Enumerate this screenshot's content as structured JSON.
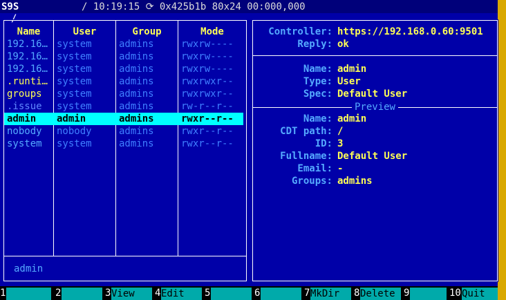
{
  "titlebar": {
    "app": "S9S",
    "status": "/ 10:19:15 ⟳ 0x425b1b 80x24 00:000,000"
  },
  "left_pane": {
    "path": "/",
    "headers": [
      "Name",
      "User",
      "Group",
      "Mode"
    ],
    "rows": [
      {
        "name": "192.16…",
        "user": "system",
        "group": "admins",
        "mode": "rwxrw----",
        "color": "#55aaff"
      },
      {
        "name": "192.16…",
        "user": "system",
        "group": "admins",
        "mode": "rwxrw----",
        "color": "#55aaff"
      },
      {
        "name": "192.16…",
        "user": "system",
        "group": "admins",
        "mode": "rwxrw----",
        "color": "#55aaff"
      },
      {
        "name": ".runti…",
        "user": "system",
        "group": "admins",
        "mode": "rwxrwxr--",
        "color": "#ffff55"
      },
      {
        "name": "groups",
        "user": "system",
        "group": "admins",
        "mode": "rwxrwxr--",
        "color": "#ffff55"
      },
      {
        "name": ".issue",
        "user": "system",
        "group": "admins",
        "mode": "rw-r--r--",
        "color": "#5f87ff"
      },
      {
        "name": "admin",
        "user": "admin",
        "group": "admins",
        "mode": "rwxr--r--",
        "color": "#000000",
        "selected": true
      },
      {
        "name": "nobody",
        "user": "nobody",
        "group": "admins",
        "mode": "rwxr--r--",
        "color": "#55aaff"
      },
      {
        "name": "system",
        "user": "system",
        "group": "admins",
        "mode": "rwxr--r--",
        "color": "#55aaff"
      }
    ],
    "current": "admin"
  },
  "right_pane": {
    "info": [
      {
        "key": "Controller:",
        "value": "https://192.168.0.60:9501"
      },
      {
        "key": "Reply:",
        "value": "ok"
      }
    ],
    "details": [
      {
        "key": "Name:",
        "value": "admin"
      },
      {
        "key": "Type:",
        "value": "User"
      },
      {
        "key": "Spec:",
        "value": "Default User"
      }
    ],
    "preview_title": "Preview",
    "preview": [
      {
        "key": "Name:",
        "value": "admin"
      },
      {
        "key": "CDT path:",
        "value": "/"
      },
      {
        "key": "ID:",
        "value": "3"
      },
      {
        "key": "Fullname:",
        "value": "Default User"
      },
      {
        "key": "Email:",
        "value": "-"
      },
      {
        "key": "Groups:",
        "value": "admins"
      }
    ]
  },
  "function_keys": [
    {
      "num": "1",
      "label": ""
    },
    {
      "num": "2",
      "label": ""
    },
    {
      "num": "3",
      "label": "View"
    },
    {
      "num": "4",
      "label": "Edit"
    },
    {
      "num": "5",
      "label": ""
    },
    {
      "num": "6",
      "label": ""
    },
    {
      "num": "7",
      "label": "MkDir"
    },
    {
      "num": "8",
      "label": "Delete"
    },
    {
      "num": "9",
      "label": ""
    },
    {
      "num": "10",
      "label": "Quit"
    }
  ]
}
